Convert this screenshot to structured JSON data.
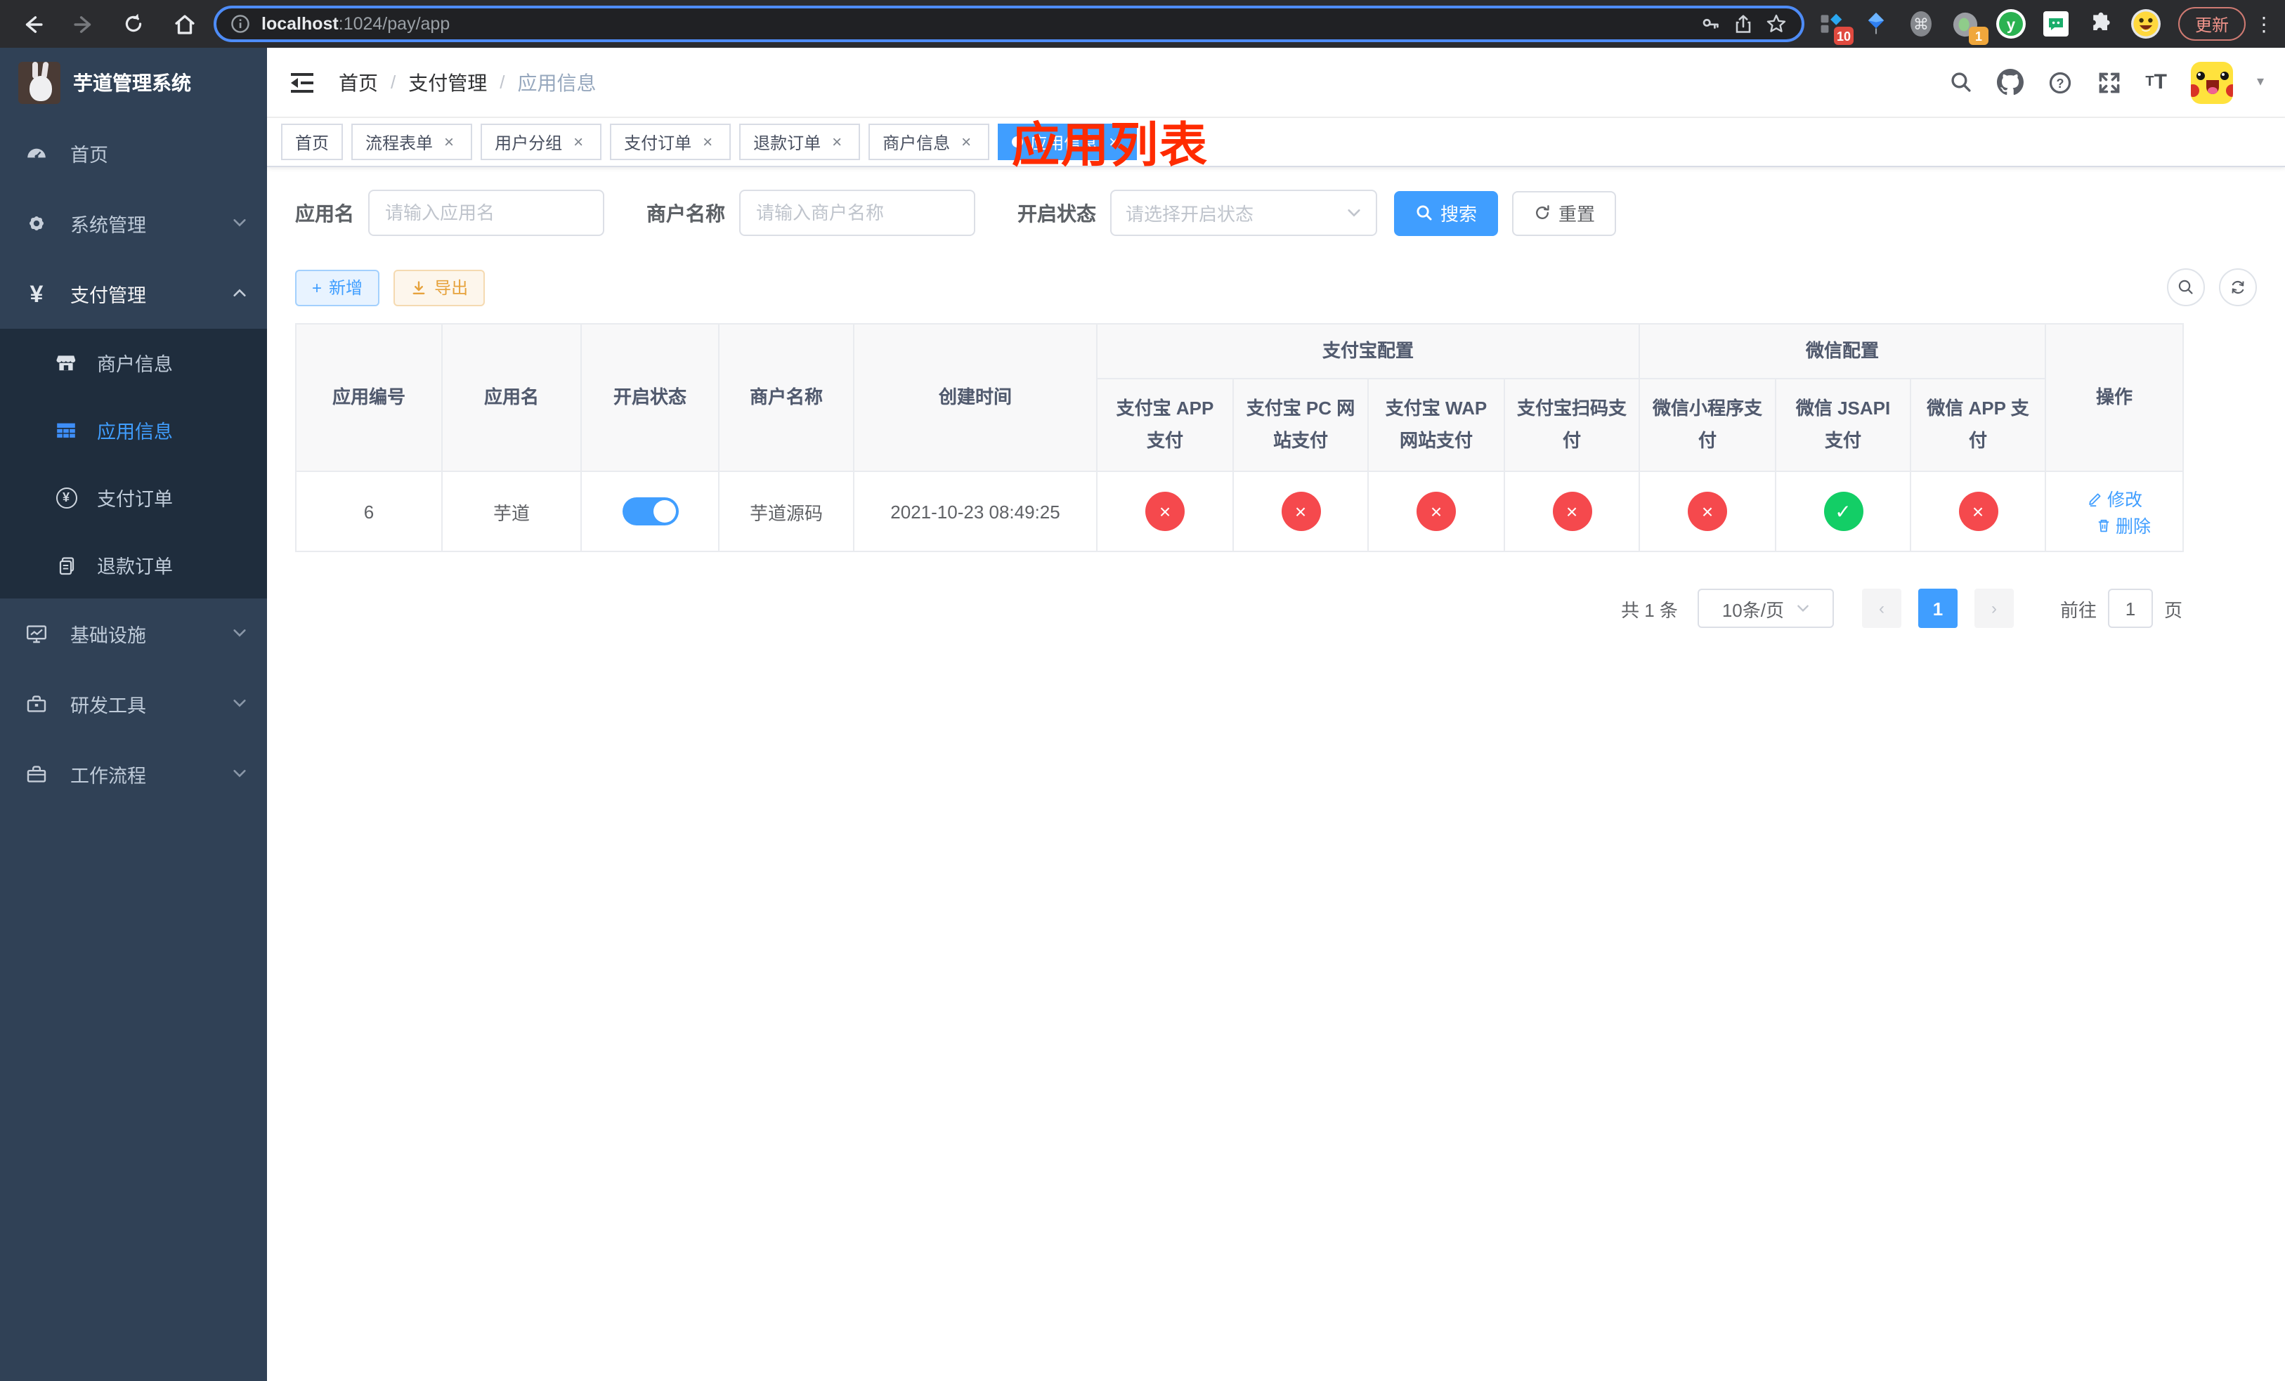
{
  "glyphs": {
    "close": "×",
    "plus": "+",
    "yen": "¥",
    "ellipsis": "⋮",
    "caret": "▾",
    "back": "←",
    "forward": "→",
    "question": "?",
    "prev": "‹",
    "next": "›"
  },
  "colors": {
    "primary": "#409eff",
    "danger": "#f5494d",
    "success": "#13ce66",
    "warning": "#e6a23c",
    "sidebar_bg": "#304156",
    "submenu_bg": "#1f2d3d"
  },
  "browser": {
    "url_host": "localhost",
    "url_rest": ":1024/pay/app",
    "update_label": "更新",
    "ext_badge_shortcuts": "10",
    "ext_badge_profile": "1",
    "ext_y_label": "y",
    "command_glyph": "⌘"
  },
  "sidebar": {
    "title": "芋道管理系统",
    "item_home": "首页",
    "item_system": "系统管理",
    "item_pay": "支付管理",
    "sub_merchant": "商户信息",
    "sub_app": "应用信息",
    "sub_order": "支付订单",
    "sub_refund": "退款订单",
    "item_infra": "基础设施",
    "item_devtool": "研发工具",
    "item_workflow": "工作流程"
  },
  "header": {
    "crumb_0": "首页",
    "crumb_1": "支付管理",
    "crumb_2": "应用信息",
    "sep": "/",
    "annotation": "应用列表"
  },
  "tabs": {
    "t0": "首页",
    "t1": "流程表单",
    "t2": "用户分组",
    "t3": "支付订单",
    "t4": "退款订单",
    "t5": "商户信息",
    "t6": "应用信息"
  },
  "search": {
    "label_app": "应用名",
    "ph_app": "请输入应用名",
    "label_merchant": "商户名称",
    "ph_merchant": "请输入商户名称",
    "label_status": "开启状态",
    "ph_status": "请选择开启状态",
    "btn_search": "搜索",
    "btn_reset": "重置"
  },
  "toolbar": {
    "btn_add": "新增",
    "btn_export": "导出"
  },
  "table": {
    "col_id": "应用编号",
    "col_name": "应用名",
    "col_status": "开启状态",
    "col_merchant": "商户名称",
    "col_created": "创建时间",
    "group_alipay": "支付宝配置",
    "group_wechat": "微信配置",
    "col_alipay_app": "支付宝 APP 支付",
    "col_alipay_pc": "支付宝 PC 网站支付",
    "col_alipay_wap": "支付宝 WAP 网站支付",
    "col_alipay_qr": "支付宝扫码支付",
    "col_wx_lite": "微信小程序支付",
    "col_wx_jsapi": "微信 JSAPI 支付",
    "col_wx_app": "微信 APP 支付",
    "col_action": "操作",
    "row": {
      "id": "6",
      "name": "芋道",
      "enabled": true,
      "merchant": "芋道源码",
      "created": "2021-10-23 08:49:25",
      "alipay_app": "×",
      "alipay_pc": "×",
      "alipay_wap": "×",
      "alipay_qr": "×",
      "wx_lite": "×",
      "wx_jsapi": "✓",
      "wx_app": "×",
      "action_edit": "修改",
      "action_delete": "删除"
    }
  },
  "pagination": {
    "total": "共 1 条",
    "size": "10条/页",
    "page": "1",
    "goto_prefix": "前往",
    "goto_value": "1",
    "goto_suffix": "页"
  }
}
